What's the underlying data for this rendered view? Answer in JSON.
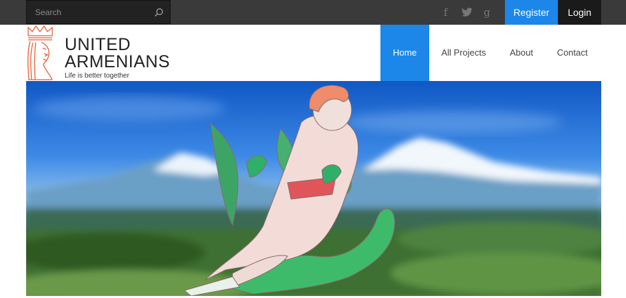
{
  "search": {
    "placeholder": "Search"
  },
  "social": {
    "facebook": "f",
    "google": "g"
  },
  "auth": {
    "register_label": "Register",
    "login_label": "Login"
  },
  "brand": {
    "line1": "UNITED",
    "line2": "ARMENIANS",
    "tagline": "Life is better together"
  },
  "nav": {
    "home": "Home",
    "projects": "All Projects",
    "about": "About",
    "contact": "Contact",
    "active": "Home"
  },
  "colors": {
    "accent": "#1c87e8",
    "topbar": "#3a3a3a",
    "login_bg": "#1a1a1a",
    "logo": "#e8603a"
  },
  "icons": [
    "search-icon",
    "facebook-icon",
    "twitter-icon",
    "google-plus-icon",
    "king-logo-icon"
  ]
}
